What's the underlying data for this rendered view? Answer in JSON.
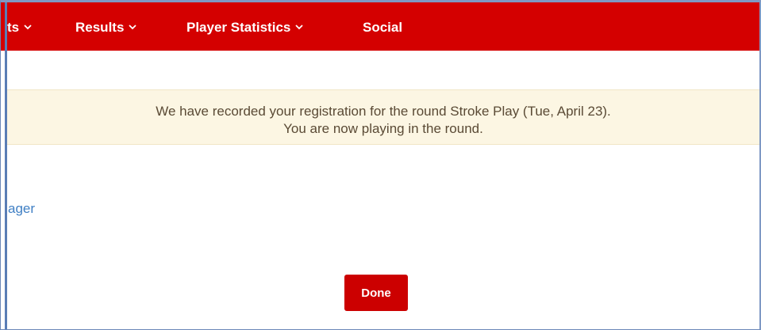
{
  "navbar": {
    "background": "#d40000",
    "items": [
      {
        "label": "ts",
        "has_dropdown": true,
        "icon": "chevron-down-icon"
      },
      {
        "label": "Results",
        "has_dropdown": true,
        "icon": "chevron-down-icon"
      },
      {
        "label": "Player Statistics",
        "has_dropdown": true,
        "icon": "chevron-down-icon"
      },
      {
        "label": "Social",
        "has_dropdown": false
      }
    ]
  },
  "alert": {
    "line1": "We have recorded your registration for the round Stroke Play (Tue, April 23).",
    "line2": "You are now playing in the round.",
    "background": "#fcf6e3"
  },
  "sidebar_link": {
    "label": "ager"
  },
  "done_button": {
    "label": "Done",
    "color": "#cc0000"
  }
}
